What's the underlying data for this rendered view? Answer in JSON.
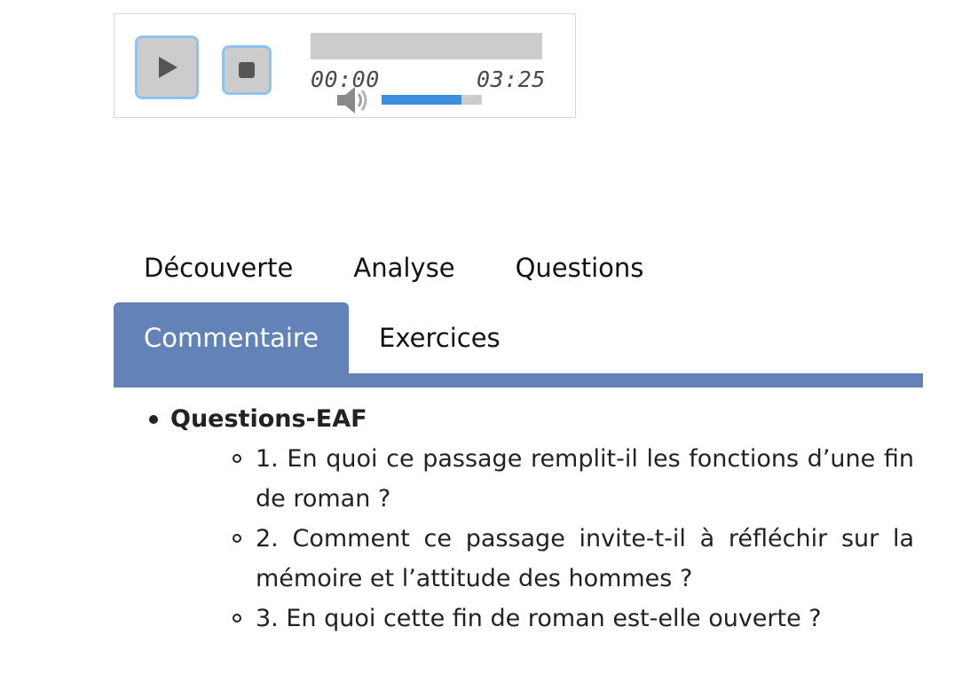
{
  "player": {
    "current_time": "00:00",
    "total_time": "03:25",
    "progress": 0.0,
    "volume": 0.8,
    "icons": {
      "play": "play-icon",
      "stop": "stop-icon",
      "volume": "speaker-icon"
    },
    "colors": {
      "button_bg": "#cccccc",
      "button_border": "#8fc3ec",
      "volume_fill": "#3d8fdc"
    }
  },
  "tabs": {
    "row1": [
      "Découverte",
      "Analyse",
      "Questions"
    ],
    "row2": [
      "Commentaire",
      "Exercices"
    ],
    "active": "Commentaire",
    "accent_color": "#6382b7"
  },
  "content": {
    "heading": "Questions-EAF",
    "questions": [
      "1. En quoi ce passage remplit-il les fonctions d’une fin de roman ?",
      "2. Comment ce passage invite-t-il à réfléchir sur la mémoire et l’attitude des hommes ?",
      "3. En quoi cette fin de roman est-elle ouverte ?"
    ]
  }
}
